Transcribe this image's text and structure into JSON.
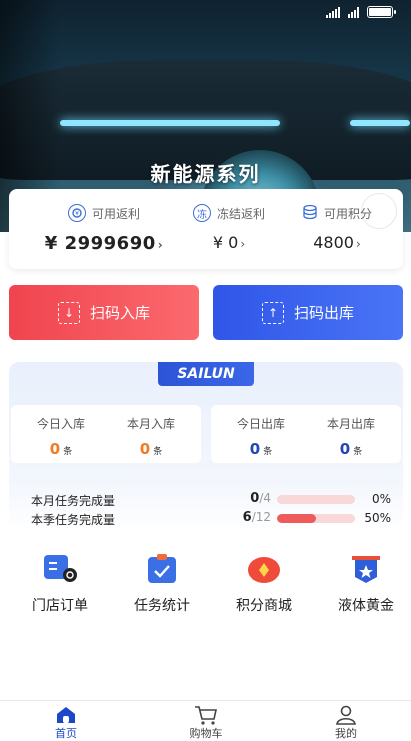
{
  "banner": {
    "title": "新能源系列"
  },
  "summary": {
    "rebate": {
      "label": "可用返利",
      "value": "¥ 2999690",
      "icon": "rebate-icon"
    },
    "frozen": {
      "label": "冻结返利",
      "value": "¥ 0",
      "icon_text": "冻"
    },
    "points": {
      "label": "可用积分",
      "value": "4800",
      "icon": "coins-icon"
    }
  },
  "actions": {
    "scan_in": "扫码入库",
    "scan_out": "扫码出库"
  },
  "stats": {
    "brand": "SAILUN",
    "today_in": {
      "label": "今日入库",
      "value": "0",
      "unit": "条"
    },
    "month_in": {
      "label": "本月入库",
      "value": "0",
      "unit": "条"
    },
    "today_out": {
      "label": "今日出库",
      "value": "0",
      "unit": "条"
    },
    "month_out": {
      "label": "本月出库",
      "value": "0",
      "unit": "条"
    },
    "monthly_task": {
      "label": "本月任务完成量",
      "done": "0",
      "total": "/4",
      "percent": "0%",
      "fraction": 0
    },
    "quarter_task": {
      "label": "本季任务完成量",
      "done": "6",
      "total": "/12",
      "percent": "50%",
      "fraction": 0.5
    }
  },
  "menu": [
    {
      "label": "门店订单",
      "icon": "store-order-icon"
    },
    {
      "label": "任务统计",
      "icon": "task-stats-icon"
    },
    {
      "label": "积分商城",
      "icon": "points-mall-icon"
    },
    {
      "label": "液体黄金",
      "icon": "liquid-gold-icon"
    }
  ],
  "tabs": [
    {
      "label": "首页",
      "icon": "home-icon",
      "active": true
    },
    {
      "label": "购物车",
      "icon": "cart-icon"
    },
    {
      "label": "我的",
      "icon": "profile-icon"
    }
  ],
  "colors": {
    "primary": "#2f56e8",
    "danger": "#f0444f",
    "orange": "#f27a22"
  }
}
